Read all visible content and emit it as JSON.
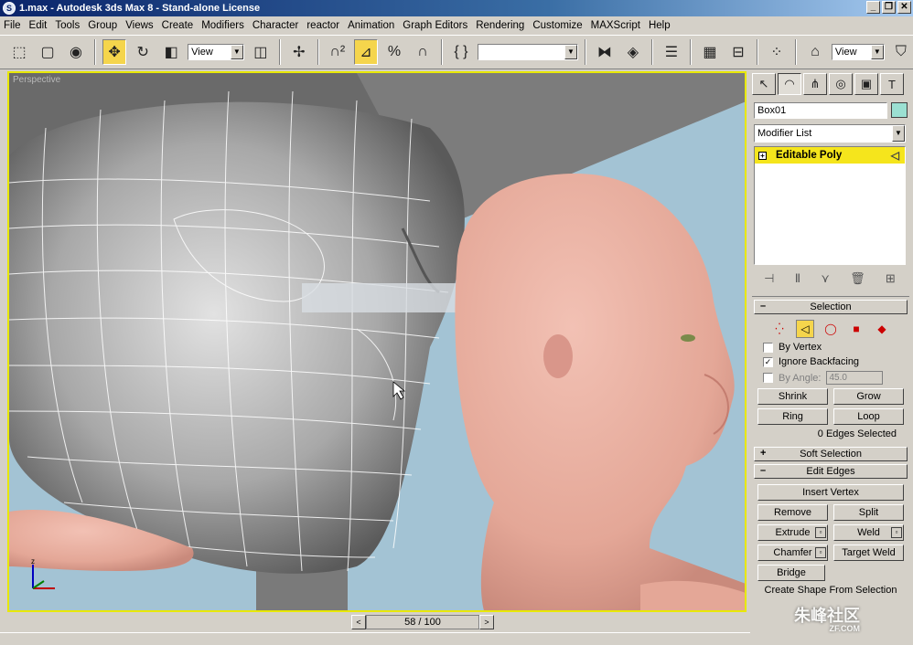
{
  "window": {
    "title": "1.max - Autodesk 3ds Max 8 - Stand-alone License",
    "app_icon": "3dsmax-logo-icon",
    "min": "_",
    "restore": "❐",
    "close": "✕"
  },
  "menu": [
    "File",
    "Edit",
    "Tools",
    "Group",
    "Views",
    "Create",
    "Modifiers",
    "Character",
    "reactor",
    "Animation",
    "Graph Editors",
    "Rendering",
    "Customize",
    "MAXScript",
    "Help"
  ],
  "toolbar": {
    "ref_coord": "View",
    "named_sel": "",
    "view2": "View"
  },
  "viewport": {
    "label": "Perspective",
    "active_border_color": "#e8e800",
    "bg_color": "#a3c3d4"
  },
  "time": {
    "frame": "58 / 100",
    "prev": "<",
    "next": ">"
  },
  "command_panel": {
    "object_name": "Box01",
    "object_color": "#9be0d2",
    "modifier_list": "Modifier List",
    "stack_item": "Editable Poly",
    "selection": {
      "title": "Selection",
      "by_vertex": "By Vertex",
      "ignore_backfacing": "Ignore Backfacing",
      "by_angle": "By Angle:",
      "angle_value": "45.0",
      "shrink": "Shrink",
      "grow": "Grow",
      "ring": "Ring",
      "loop": "Loop",
      "info": "0 Edges Selected"
    },
    "soft_selection": "Soft Selection",
    "edit_edges": {
      "title": "Edit Edges",
      "insert_vertex": "Insert Vertex",
      "remove": "Remove",
      "split": "Split",
      "extrude": "Extrude",
      "weld": "Weld",
      "chamfer": "Chamfer",
      "target_weld": "Target Weld",
      "bridge": "Bridge",
      "create_shape": "Create Shape From Selection"
    }
  },
  "watermark": {
    "text": "朱峰社区",
    "sub": "ZF.COM"
  }
}
